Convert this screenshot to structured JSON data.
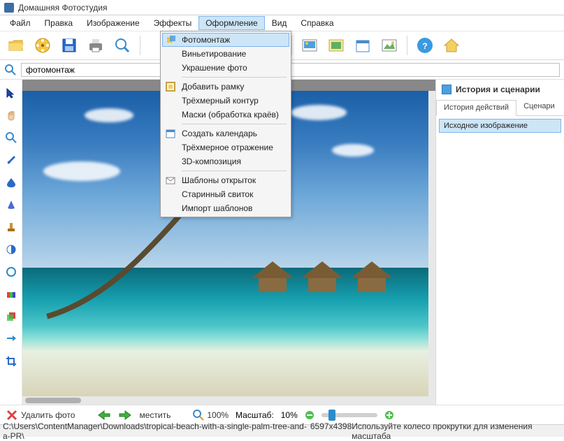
{
  "app": {
    "title": "Домашняя Фотостудия"
  },
  "menu": {
    "file": "Файл",
    "edit": "Правка",
    "image": "Изображение",
    "effects": "Эффекты",
    "design": "Оформление",
    "view": "Вид",
    "help": "Справка"
  },
  "dropdown": {
    "photomontage": "Фотомонтаж",
    "vignetting": "Виньетирование",
    "decoration": "Украшение фото",
    "add_frame": "Добавить рамку",
    "contour_3d": "Трёхмерный контур",
    "masks": "Маски (обработка краёв)",
    "calendar": "Создать календарь",
    "reflection_3d": "Трёхмерное отражение",
    "composition_3d": "3D-композиция",
    "postcard_templates": "Шаблоны открыток",
    "old_scroll": "Старинный свиток",
    "import_templates": "Импорт шаблонов"
  },
  "search": {
    "value": "фотомонтаж"
  },
  "right_panel": {
    "title": "История и сценарии",
    "tab_history": "История действий",
    "tab_scenarios": "Сценари",
    "item_original": "Исходное изображение"
  },
  "bottom": {
    "delete_photo": "Удалить фото",
    "fit": "местить",
    "zoom_100": "100%",
    "scale_label": "Масштаб:",
    "scale_value": "10%"
  },
  "status": {
    "path": "C:\\Users\\ContentManager\\Downloads\\tropical-beach-with-a-single-palm-tree-and-a-PR\\",
    "dimensions": "6597x4398",
    "hint": "Используйте колесо прокрутки для изменения масштаба"
  }
}
